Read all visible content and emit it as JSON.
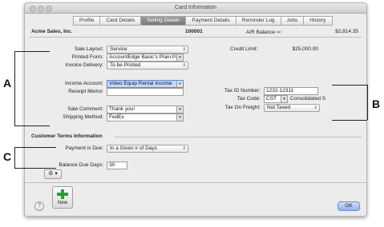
{
  "window": {
    "title": "Card Information"
  },
  "tabs": [
    "Profile",
    "Card Details",
    "Selling Details",
    "Payment Details",
    "Reminder Log",
    "Jobs",
    "History"
  ],
  "active_tab": "Selling Details",
  "header": {
    "customer_name": "Acme Sales, Inc.",
    "card_id": "100001",
    "ar_label": "A/R Balance ⇨:",
    "ar_value": "$2,814.35"
  },
  "form": {
    "sale_layout": {
      "label": "Sale Layout:",
      "value": "Service"
    },
    "printed_form": {
      "label": "Printed Form:",
      "value": "AccountEdge Basic's Plain Pa"
    },
    "invoice_delivery": {
      "label": "Invoice Delivery:",
      "value": "To be Printed"
    },
    "credit_limit": {
      "label": "Credit Limit:",
      "value": "$25,000.00"
    },
    "income_account": {
      "label": "Income Account:",
      "value": "Video Equip Rental Income"
    },
    "receipt_memo": {
      "label": "Receipt Memo:",
      "value": ""
    },
    "tax_id": {
      "label": "Tax ID Number:",
      "value": "1232-12311"
    },
    "tax_code": {
      "label": "Tax Code:",
      "value": "CST",
      "extra": "Consolidated S"
    },
    "sale_comment": {
      "label": "Sale Comment:",
      "value": "Thank you!"
    },
    "tax_on_freight": {
      "label": "Tax On Freight:",
      "value": "Not Taxed"
    },
    "shipping_method": {
      "label": "Shipping Method:",
      "value": "FedEx"
    }
  },
  "terms": {
    "heading": "Customer Terms Information",
    "payment_due": {
      "label": "Payment is Due:",
      "value": "In a Given # of Days"
    },
    "balance_due_days": {
      "label": "Balance Due Days:",
      "value": "30"
    }
  },
  "buttons": {
    "new": "New",
    "ok": "OK",
    "help": "?",
    "gear": "⚙ ▾"
  },
  "callouts": {
    "a": "A",
    "b": "B",
    "c": "C"
  },
  "icons": {
    "new_icon": "plus-icon",
    "gear_icon": "gear-icon",
    "help_icon": "help-icon"
  }
}
